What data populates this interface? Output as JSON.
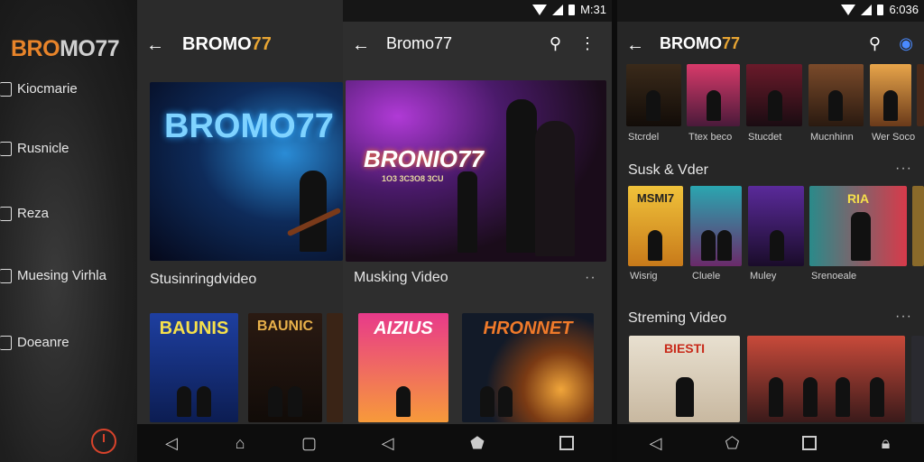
{
  "drawer": {
    "logo_a": "BRO",
    "logo_b": "MO77",
    "items": [
      {
        "label": "Kiocmarie"
      },
      {
        "label": "Rusnicle"
      },
      {
        "label": "Reza"
      },
      {
        "label": "Muesing Virhla"
      },
      {
        "label": "Doeanre"
      }
    ],
    "clock_icon": "clock-icon"
  },
  "panel1": {
    "title_a": "BROMO",
    "title_b": "77",
    "hero_text": "BROMO77",
    "section": "Stusinringdvideo",
    "thumbs": [
      {
        "text": "BAUNIS"
      },
      {
        "text": "BAUNIC"
      }
    ]
  },
  "panel2": {
    "status_time": "M:31",
    "title": "Bromo77",
    "hero_text": "BRONIO77",
    "hero_sub": "1O3 3C3O8 3CU",
    "section": "Musking Video",
    "more": "··",
    "thumbs": [
      {
        "text": "AIZIUS"
      },
      {
        "text": "HRONNET"
      }
    ]
  },
  "panel3": {
    "status_time": "6:036",
    "title_a": "BROMO",
    "title_b": "77",
    "row1_captions": [
      "Stcrdel",
      "Ttex beco",
      "Stucdet",
      "Mucnhinn",
      "Wer Soco"
    ],
    "section2": "Susk & Vder",
    "row2_captions": [
      "Wisrig",
      "Cluele",
      "Muley",
      "Srenoeale"
    ],
    "row2_thumb_text": [
      "MSMI7",
      "",
      "",
      "RIA"
    ],
    "section3": "Streming Video",
    "row3_thumb_text": [
      "BIESTI",
      ""
    ],
    "more": "···"
  }
}
